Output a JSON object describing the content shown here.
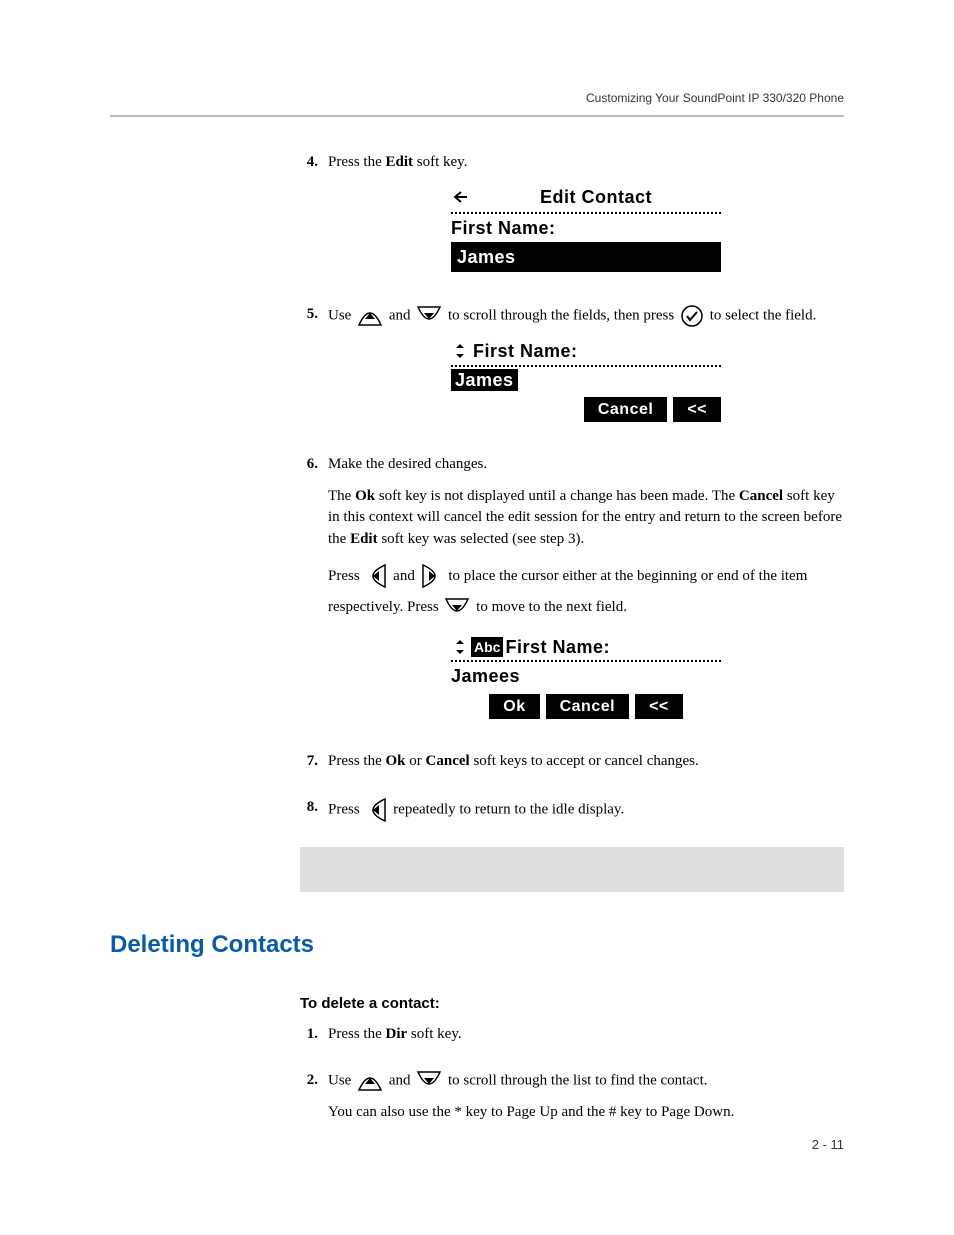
{
  "header": {
    "right": "Customizing Your SoundPoint IP 330/320 Phone"
  },
  "steps": {
    "s4": {
      "num": "4.",
      "text_a": "Press the ",
      "bold_a": "Edit",
      "text_b": " soft key."
    },
    "s5": {
      "num": "5.",
      "a": "Use ",
      "b": " and ",
      "c": " to scroll through the fields, then press ",
      "d": " to select the field."
    },
    "s6": {
      "num": "6.",
      "line1": "Make the desired changes.",
      "p2_a": "The ",
      "p2_b": "Ok",
      "p2_c": " soft key is not displayed until a change has been made. The ",
      "p2_d": "Cancel",
      "p2_e": " soft key in this context will cancel the edit session for the entry and return to the screen before the ",
      "p2_f": "Edit",
      "p2_g": " soft key was selected (see step 3).",
      "p3_a": "Press ",
      "p3_b": " and ",
      "p3_c": " to place the cursor either at the beginning or end of the item respectively. Press ",
      "p3_d": " to move to the next field."
    },
    "s7": {
      "num": "7.",
      "a": "Press the ",
      "b": "Ok",
      "c": " or ",
      "d": "Cancel",
      "e": " soft keys to accept or cancel changes."
    },
    "s8": {
      "num": "8.",
      "a": "Press ",
      "b": " repeatedly to return to the idle display."
    }
  },
  "lcd1": {
    "title": "Edit Contact",
    "label": "First Name:",
    "value": "James"
  },
  "lcd2": {
    "label": "First Name:",
    "value": "James",
    "sk1": "Cancel",
    "sk2": "<<"
  },
  "lcd3": {
    "badge": "Abc",
    "label": "First Name:",
    "value": "Jamees",
    "sk1": "Ok",
    "sk2": "Cancel",
    "sk3": "<<"
  },
  "section": {
    "heading": "Deleting Contacts"
  },
  "delete": {
    "sub": "To delete a contact:",
    "s1": {
      "num": "1.",
      "a": "Press the ",
      "b": "Dir",
      "c": " soft key."
    },
    "s2": {
      "num": "2.",
      "a": "Use ",
      "b": " and ",
      "c": " to scroll through the list to find the contact.",
      "line2": "You can also use the * key to Page Up and the # key to Page Down."
    }
  },
  "footer": {
    "pagenum": "2 - 11"
  }
}
